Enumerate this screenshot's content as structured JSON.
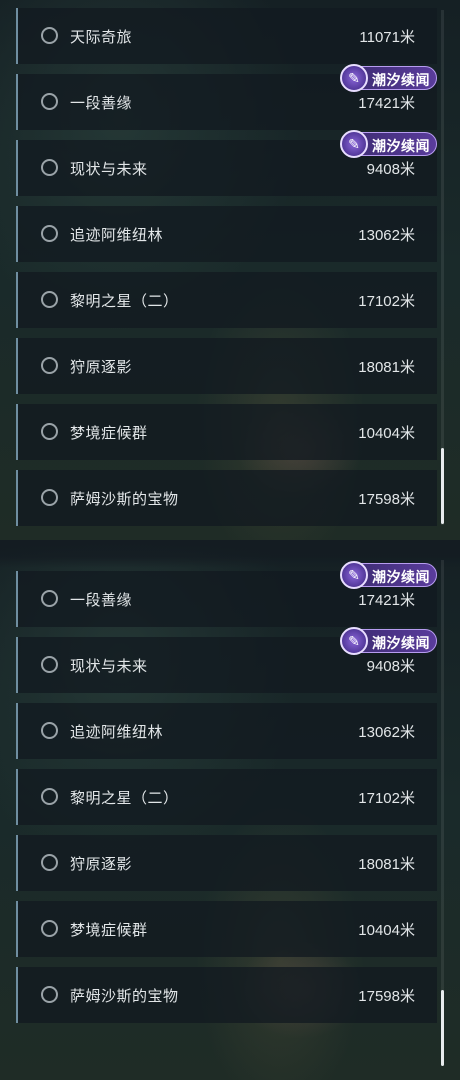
{
  "badge_label": "潮汐续闻",
  "distance_unit": "米",
  "top_list": [
    {
      "name": "天际奇旅",
      "distance": "11071米",
      "badge": false
    },
    {
      "name": "一段善缘",
      "distance": "17421米",
      "badge": true
    },
    {
      "name": "现状与未来",
      "distance": "9408米",
      "badge": true
    },
    {
      "name": "追迹阿维纽林",
      "distance": "13062米",
      "badge": false
    },
    {
      "name": "黎明之星（二）",
      "distance": "17102米",
      "badge": false
    },
    {
      "name": "狩原逐影",
      "distance": "18081米",
      "badge": false
    },
    {
      "name": "梦境症候群",
      "distance": "10404米",
      "badge": false
    },
    {
      "name": "萨姆沙斯的宝物",
      "distance": "17598米",
      "badge": false
    }
  ],
  "bottom_list": [
    {
      "name": "一段善缘",
      "distance": "17421米",
      "badge": true
    },
    {
      "name": "现状与未来",
      "distance": "9408米",
      "badge": true
    },
    {
      "name": "追迹阿维纽林",
      "distance": "13062米",
      "badge": false
    },
    {
      "name": "黎明之星（二）",
      "distance": "17102米",
      "badge": false
    },
    {
      "name": "狩原逐影",
      "distance": "18081米",
      "badge": false
    },
    {
      "name": "梦境症候群",
      "distance": "10404米",
      "badge": false
    },
    {
      "name": "萨姆沙斯的宝物",
      "distance": "17598米",
      "badge": false
    }
  ]
}
